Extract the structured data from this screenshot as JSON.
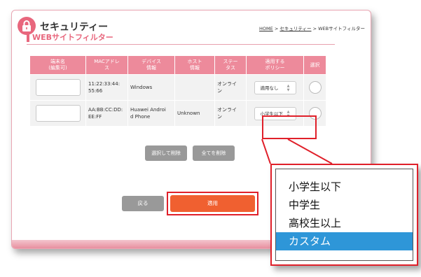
{
  "header": {
    "title": "セキュリティー",
    "breadcrumb": {
      "home": "HOME",
      "sep1": ">",
      "security": "セキュリティー",
      "sep2": ">",
      "current": "WEBサイトフィルター"
    }
  },
  "section": {
    "title": "WEBサイトフィルター"
  },
  "table": {
    "headers": [
      {
        "line1": "端末名",
        "line2": "(編集可)"
      },
      {
        "line1": "MACアドレ",
        "line2": "ス"
      },
      {
        "line1": "デバイス",
        "line2": "情報"
      },
      {
        "line1": "ホスト",
        "line2": "情報"
      },
      {
        "line1": "ステー",
        "line2": "タス"
      },
      {
        "line1": "適用する",
        "line2": "ポリシー"
      },
      {
        "line1": "選択",
        "line2": ""
      }
    ],
    "rows": [
      {
        "name": "",
        "mac1": "11:22:33:44:",
        "mac2": "55:66",
        "device1": "Windows",
        "device2": "",
        "host": "",
        "status1": "オンライ",
        "status2": "ン",
        "policy": "適用なし"
      },
      {
        "name": "",
        "mac1": "AA:BB:CC:DD:",
        "mac2": "EE:FF",
        "device1": "Huawei Androi",
        "device2": "d Phone",
        "host": "Unknown",
        "status1": "オンライ",
        "status2": "ン",
        "policy": "小学生以下"
      }
    ]
  },
  "actions": {
    "delete_selected": "選択して削除",
    "delete_all": "全てを削除",
    "back": "戻る",
    "apply": "適用"
  },
  "dropdown": {
    "options": [
      "小学生以下",
      "中学生",
      "高校生以上",
      "カスタム"
    ],
    "highlighted": "カスタム"
  },
  "colors": {
    "accent": "#e8677d",
    "header_bg": "#ed8a9b",
    "apply": "#f06030",
    "highlight": "#e0202a",
    "selected_option": "#2e96d8"
  }
}
